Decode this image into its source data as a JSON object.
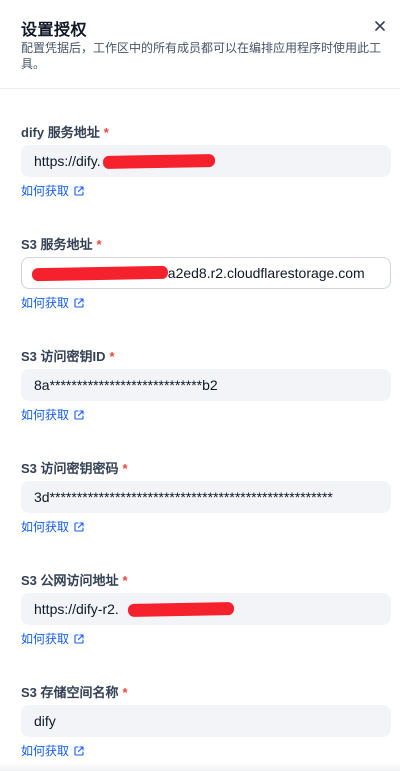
{
  "dialog": {
    "title": "设置授权",
    "description": "配置凭据后，工作区中的所有成员都可以在编排应用程序时使用此工具。",
    "close_icon": "close-icon"
  },
  "colors": {
    "required": "#f04438",
    "link": "#155eef",
    "input_bg": "#f2f4f7",
    "redaction": "#f5222d"
  },
  "fields": [
    {
      "label": "dify 服务地址",
      "required": "*",
      "value": "https://dify.",
      "help": "如何获取"
    },
    {
      "label": "S3 服务地址",
      "required": "*",
      "value": "6a2ed8.r2.cloudflarestorage.com",
      "help": "如何获取"
    },
    {
      "label": "S3 访问密钥ID",
      "required": "*",
      "value": "8a****************************b2",
      "help": "如何获取"
    },
    {
      "label": "S3 访问密钥密码",
      "required": "*",
      "value": "3d****************************************************",
      "help": "如何获取"
    },
    {
      "label": "S3 公网访问地址",
      "required": "*",
      "value": "https://dify-r2.",
      "help": "如何获取"
    },
    {
      "label": "S3 存储空间名称",
      "required": "*",
      "value": "dify",
      "help": "如何获取"
    }
  ]
}
